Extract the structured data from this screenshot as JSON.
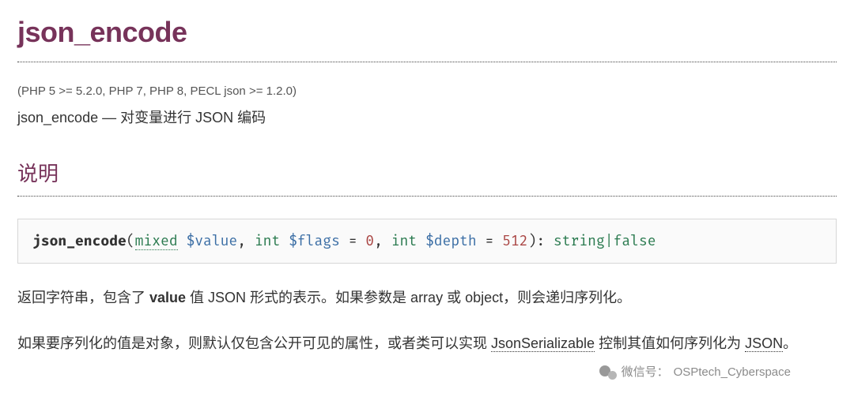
{
  "title": "json_encode",
  "version": "(PHP 5 >= 5.2.0, PHP 7, PHP 8, PECL json >= 1.2.0)",
  "summary": "json_encode — 对变量进行 JSON 编码",
  "section_heading": "说明",
  "signature": {
    "fn": "json_encode",
    "p1_type": "mixed",
    "p1_var": "$value",
    "p2_type": "int",
    "p2_var": "$flags",
    "p2_default": "0",
    "p3_type": "int",
    "p3_var": "$depth",
    "p3_default": "512",
    "ret": "string|false"
  },
  "para1": {
    "a": "返回字符串，包含了 ",
    "kw": "value",
    "b": " 值 JSON 形式的表示。如果参数是 array 或 object，则会递归序列化。"
  },
  "para2": {
    "a": "如果要序列化的值是对象，则默认仅包含公开可见的属性，或者类可以实现 ",
    "link": "JsonSerializable",
    "b": " 控制其值如何序列化为 ",
    "json": "JSON",
    "c": "。"
  },
  "watermark": {
    "label": "微信号：",
    "handle": "OSPtech_Cyberspace"
  }
}
